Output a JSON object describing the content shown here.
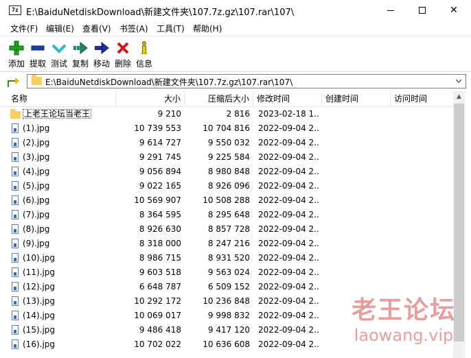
{
  "window": {
    "app_icon_text": "7z",
    "title": "E:\\BaiduNetdiskDownload\\新建文件夹\\107.7z.gz\\107.rar\\107\\",
    "close_glyph": "✕"
  },
  "menu": [
    "文件(F)",
    "编辑(E)",
    "查看(V)",
    "书签(A)",
    "工具(T)",
    "帮助(H)"
  ],
  "toolbar": [
    {
      "label": "添加",
      "icon": "add-icon",
      "color": "#1aa51a"
    },
    {
      "label": "提取",
      "icon": "extract-icon",
      "color": "#1f3fa8"
    },
    {
      "label": "测试",
      "icon": "test-icon",
      "color": "#2ab8c8"
    },
    {
      "label": "复制",
      "icon": "copy-icon",
      "color": "#1a8a6a"
    },
    {
      "label": "移动",
      "icon": "move-icon",
      "color": "#1f2f9a"
    },
    {
      "label": "删除",
      "icon": "delete-icon",
      "color": "#d0161c"
    },
    {
      "label": "信息",
      "icon": "info-icon",
      "color": "#c9b300"
    }
  ],
  "address": {
    "path": "E:\\BaiduNetdiskDownload\\新建文件夹\\107.7z.gz\\107.rar\\107\\"
  },
  "columns": {
    "name": "名称",
    "size": "大小",
    "packed": "压缩后大小",
    "modified": "修改时间",
    "created": "创建时间",
    "accessed": "访问时间"
  },
  "rows": [
    {
      "type": "folder",
      "name": "上老王论坛当老王",
      "size": "9 210",
      "packed": "2 816",
      "modified": "2023-02-18 1..."
    },
    {
      "type": "file",
      "name": "(1).jpg",
      "size": "10 739 553",
      "packed": "10 704 816",
      "modified": "2022-09-04 2..."
    },
    {
      "type": "file",
      "name": "(2).jpg",
      "size": "9 614 727",
      "packed": "9 550 032",
      "modified": "2022-09-04 2..."
    },
    {
      "type": "file",
      "name": "(3).jpg",
      "size": "9 291 745",
      "packed": "9 225 584",
      "modified": "2022-09-04 2..."
    },
    {
      "type": "file",
      "name": "(4).jpg",
      "size": "9 056 894",
      "packed": "8 980 848",
      "modified": "2022-09-04 2..."
    },
    {
      "type": "file",
      "name": "(5).jpg",
      "size": "9 022 165",
      "packed": "8 926 096",
      "modified": "2022-09-04 2..."
    },
    {
      "type": "file",
      "name": "(6).jpg",
      "size": "10 569 907",
      "packed": "10 508 288",
      "modified": "2022-09-04 2..."
    },
    {
      "type": "file",
      "name": "(7).jpg",
      "size": "8 364 595",
      "packed": "8 295 648",
      "modified": "2022-09-04 2..."
    },
    {
      "type": "file",
      "name": "(8).jpg",
      "size": "8 926 630",
      "packed": "8 857 728",
      "modified": "2022-09-04 2..."
    },
    {
      "type": "file",
      "name": "(9).jpg",
      "size": "8 318 000",
      "packed": "8 247 216",
      "modified": "2022-09-04 2..."
    },
    {
      "type": "file",
      "name": "(10).jpg",
      "size": "8 986 715",
      "packed": "8 931 520",
      "modified": "2022-09-04 2..."
    },
    {
      "type": "file",
      "name": "(11).jpg",
      "size": "9 603 518",
      "packed": "9 563 024",
      "modified": "2022-09-04 2..."
    },
    {
      "type": "file",
      "name": "(12).jpg",
      "size": "6 648 787",
      "packed": "6 509 152",
      "modified": "2022-09-04 2..."
    },
    {
      "type": "file",
      "name": "(13).jpg",
      "size": "10 292 172",
      "packed": "10 236 848",
      "modified": "2022-09-04 2..."
    },
    {
      "type": "file",
      "name": "(14).jpg",
      "size": "10 069 017",
      "packed": "9 998 832",
      "modified": "2022-09-04 2..."
    },
    {
      "type": "file",
      "name": "(15).jpg",
      "size": "9 486 418",
      "packed": "9 417 120",
      "modified": "2022-09-04 2..."
    },
    {
      "type": "file",
      "name": "(16).jpg",
      "size": "10 702 022",
      "packed": "10 636 608",
      "modified": "2022-09-04 2..."
    }
  ],
  "watermark": {
    "cn": "老王论坛",
    "en": "laowang.vip"
  }
}
